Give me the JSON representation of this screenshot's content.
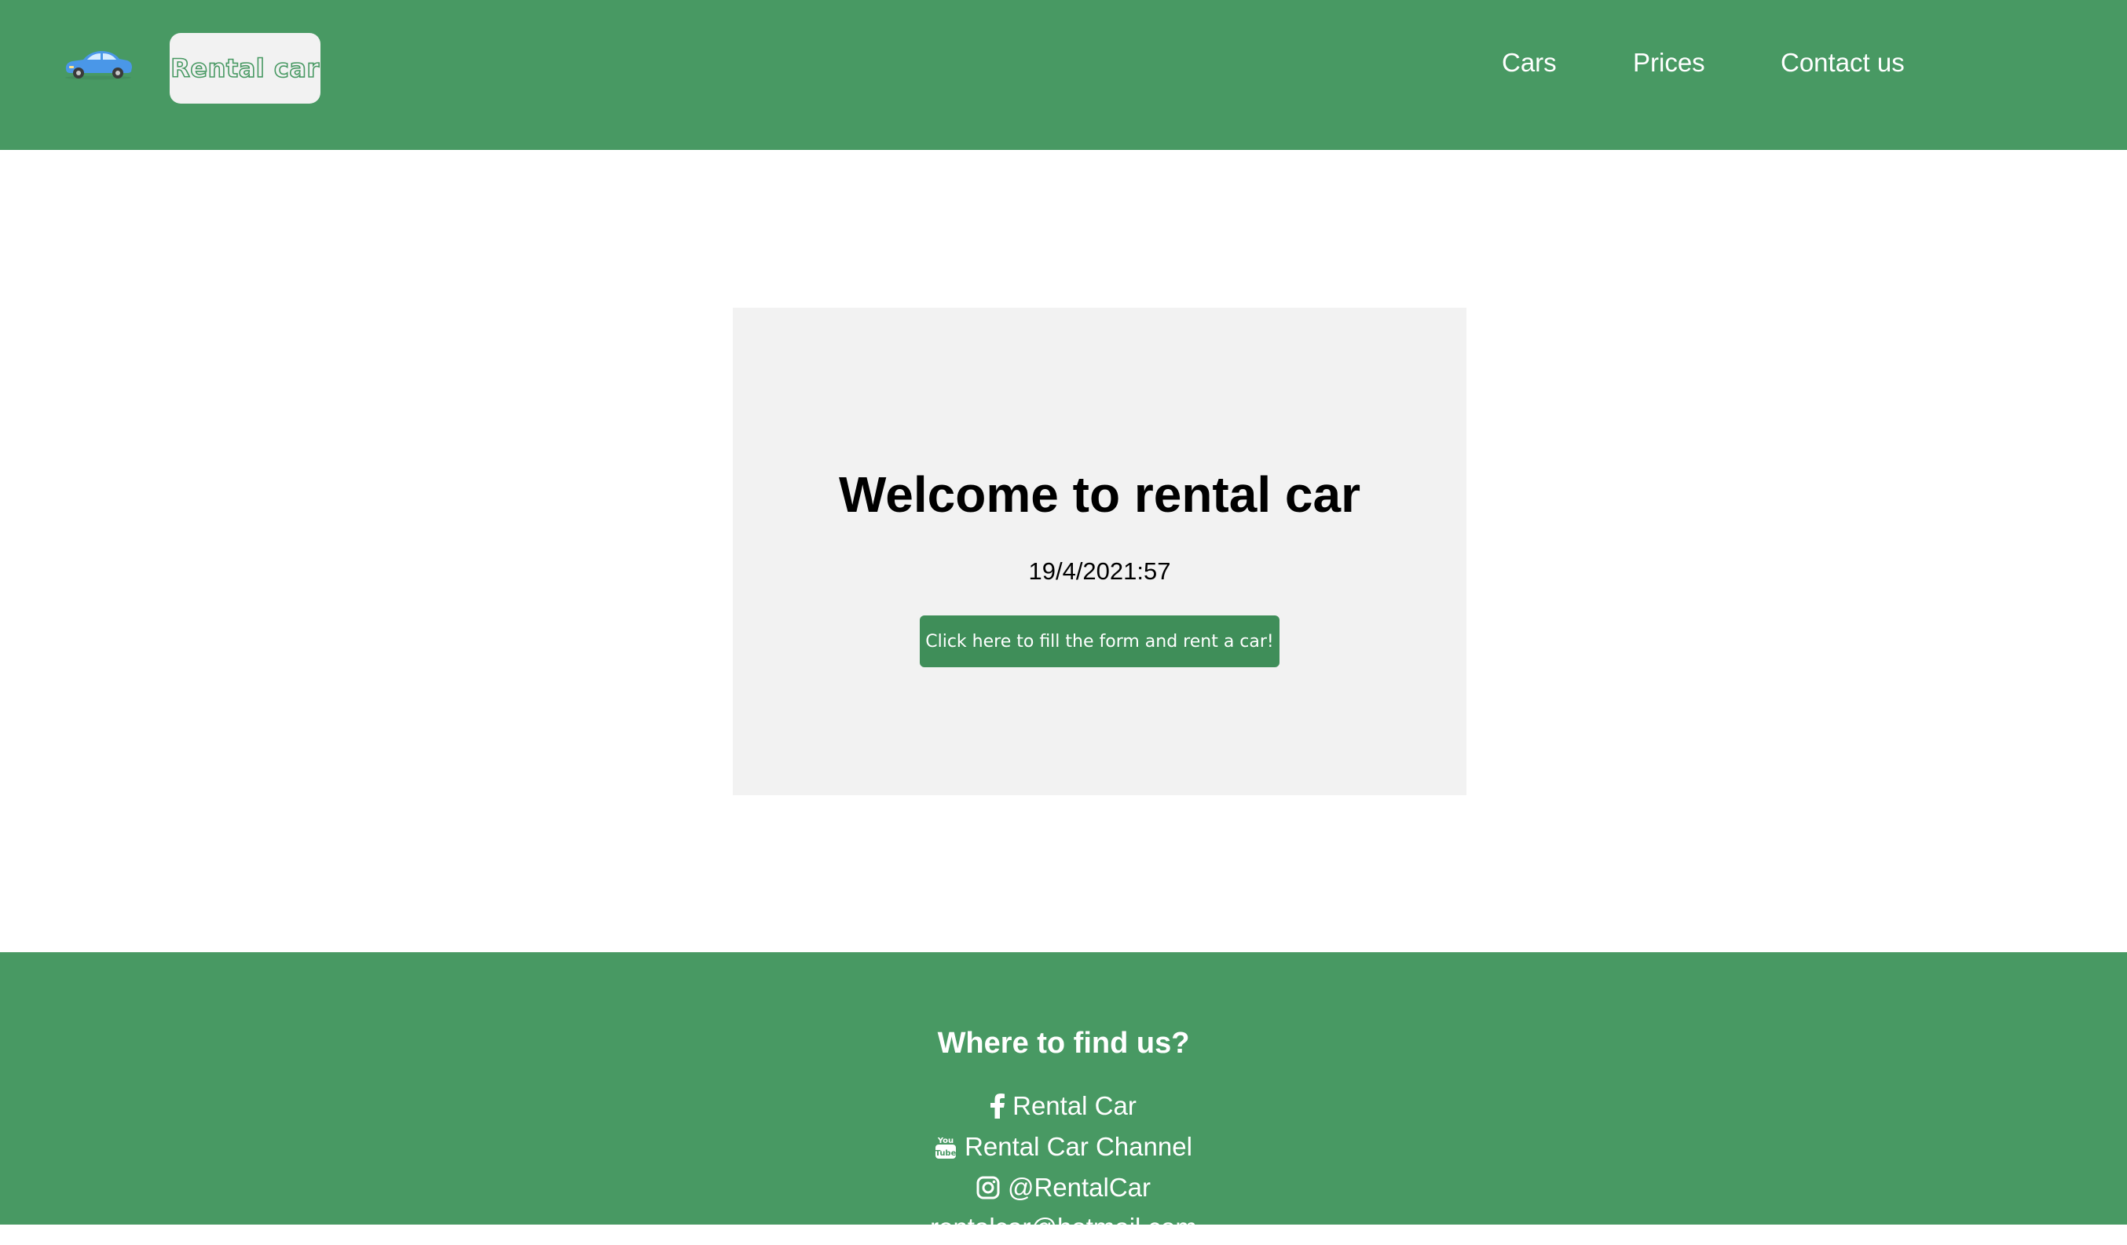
{
  "header": {
    "brand_label": "Rental car",
    "logo_icon": "car-icon",
    "nav": {
      "cars": "Cars",
      "prices": "Prices",
      "contact": "Contact us"
    }
  },
  "main": {
    "title": "Welcome to rental car",
    "datetime": "19/4/2021:57",
    "cta_label": "Click here to fill the form and rent a car!"
  },
  "footer": {
    "title": "Where to find us?",
    "facebook": "Rental Car",
    "youtube": "Rental Car Channel",
    "instagram": "@RentalCar",
    "email": "rentalcar@hotmail.com"
  },
  "colors": {
    "brand_green": "#489963",
    "button_green": "#3f8e59",
    "card_gray": "#f2f2f2"
  }
}
